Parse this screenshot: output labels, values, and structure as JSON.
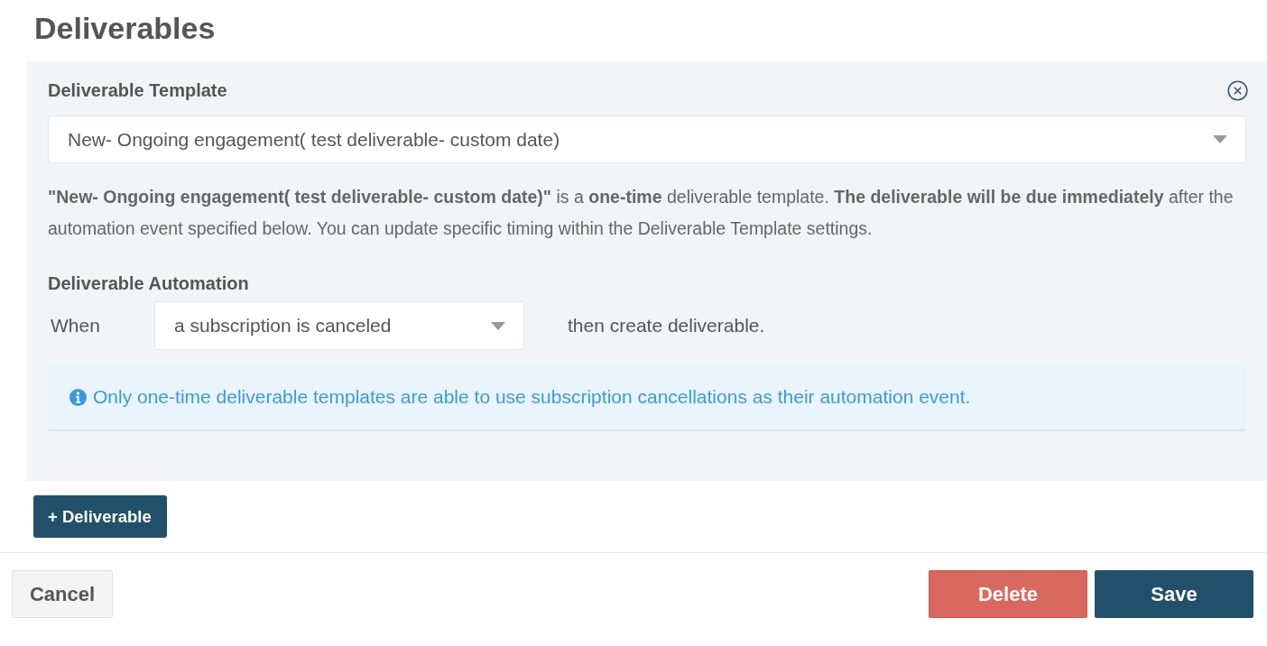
{
  "page_title": "Deliverables",
  "deliverable": {
    "template_label": "Deliverable Template",
    "template_select": {
      "value": "New- Ongoing engagement( test deliverable- custom date)"
    },
    "description": "**\"New- Ongoing engagement( test deliverable- custom date)\"** is a **one-time** deliverable template. **The deliverable will be due immediately** after the automation event specified below. You can update specific timing within the Deliverable Template settings.",
    "automation_label": "Deliverable Automation",
    "when_label": "When",
    "trigger_select": {
      "value": "a subscription is canceled"
    },
    "then_label": "then create deliverable.",
    "info": "Only one-time deliverable templates are able to use subscription cancellations as their automation event."
  },
  "add_button": "+ Deliverable",
  "footer": {
    "cancel": "Cancel",
    "delete": "Delete",
    "save": "Save"
  }
}
